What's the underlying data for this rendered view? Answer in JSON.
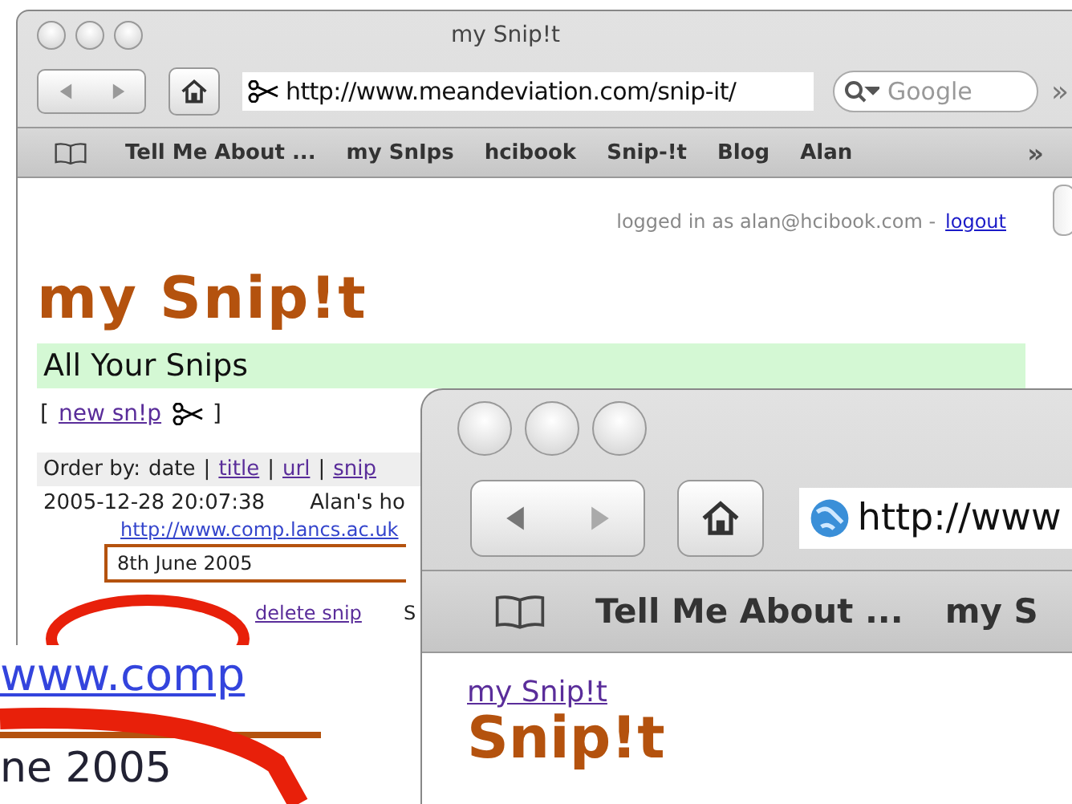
{
  "back_window": {
    "title": "my Snip!t",
    "url": "http://www.meandeviation.com/snip-it/",
    "search_placeholder": "Google",
    "overflow": "»",
    "bookmarks": [
      "Tell Me About ...",
      "my SnIps",
      "hcibook",
      "Snip-!t",
      "Blog",
      "Alan"
    ],
    "bookmarks_overflow": "»",
    "page": {
      "login_text": "logged in as alan@hcibook.com -",
      "logout_link": "logout",
      "logo": "my Snip!t",
      "section_title": "All Your Snips",
      "new_snip": {
        "open": "[",
        "link": "new sn!p",
        "close": "]"
      },
      "order_by": {
        "label": "Order by:",
        "separator": "|",
        "options": [
          {
            "label": "date",
            "selected": true
          },
          {
            "label": "title",
            "selected": false
          },
          {
            "label": "url",
            "selected": false
          },
          {
            "label": "snip",
            "selected": false
          }
        ]
      },
      "snip": {
        "date": "2005-12-28 20:07:38",
        "title": "Alan's ho",
        "url": "http://www.comp.lancs.ac.uk",
        "note": "8th June 2005",
        "delete_link": "delete snip",
        "column_3": "S"
      }
    }
  },
  "magnifier": {
    "url_fragment": "www.comp",
    "note_fragment": "ne 2005"
  },
  "front_window": {
    "url": "http://www",
    "bookmarks": [
      "Tell Me About ...",
      "my S"
    ],
    "page": {
      "breadcrumb": "my Snip!t",
      "logo": "Snip!t"
    }
  }
}
